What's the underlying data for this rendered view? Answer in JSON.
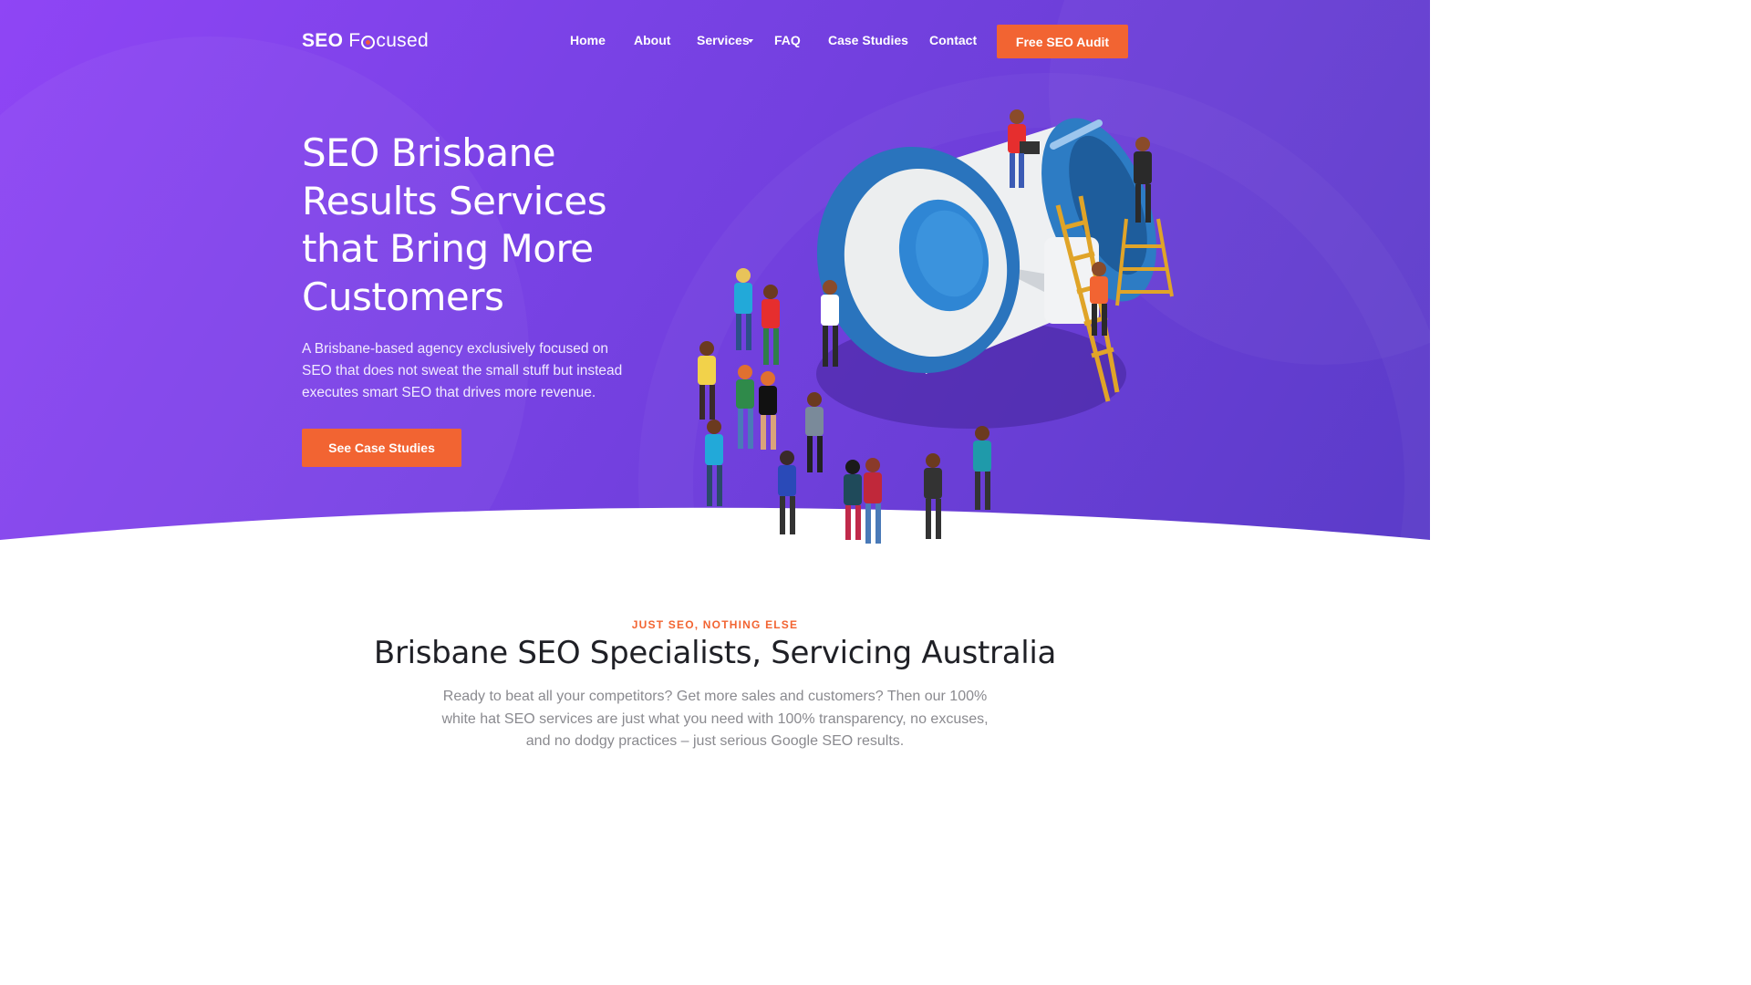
{
  "brand": {
    "logo_part1": "SEO",
    "logo_part2a": "F",
    "logo_part2b": "cused"
  },
  "nav": {
    "items": [
      {
        "label": "Home"
      },
      {
        "label": "About"
      },
      {
        "label": "Services"
      },
      {
        "label": "FAQ"
      },
      {
        "label": "Case Studies"
      },
      {
        "label": "Contact"
      }
    ],
    "audit_button": "Free SEO Audit"
  },
  "hero": {
    "title": "SEO Brisbane Results Services that Bring More Customers",
    "subtitle": "A Brisbane-based agency exclusively focused on SEO that does not sweat the small stuff but instead executes smart SEO that drives more revenue.",
    "cta": "See Case Studies",
    "illustration_icon": "megaphone-crowd-illustration"
  },
  "section": {
    "eyebrow": "JUST SEO, NOTHING ELSE",
    "title": "Brisbane SEO Specialists, Servicing Australia",
    "body": "Ready to beat all your competitors? Get more sales and customers? Then our 100% white hat SEO services are just what you need with 100% transparency, no excuses, and no dodgy practices – just serious Google SEO results."
  },
  "colors": {
    "accent": "#f26432",
    "hero_start": "#8f45f5",
    "hero_end": "#5a3cc8",
    "heading": "#1f2026",
    "body": "#8a8a8f"
  }
}
